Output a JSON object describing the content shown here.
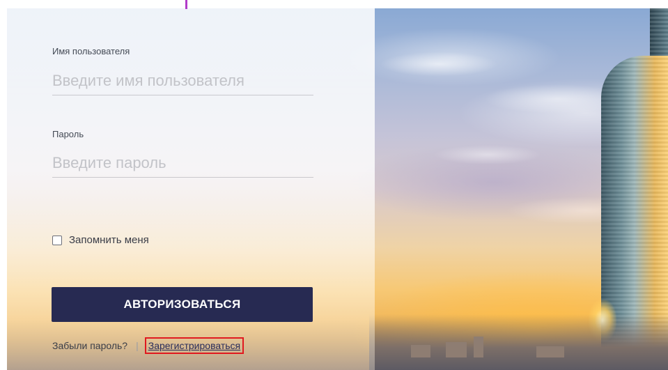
{
  "login": {
    "username_label": "Имя пользователя",
    "username_placeholder": "Введите имя пользователя",
    "password_label": "Пароль",
    "password_placeholder": "Введите пароль",
    "remember_label": "Запомнить меня",
    "remember_checked": false,
    "submit_label": "АВТОРИЗОВАТЬСЯ",
    "forgot_label": "Забыли пароль?",
    "separator": "|",
    "register_label": "Зарегистрироваться"
  },
  "colors": {
    "button_bg": "#272a52",
    "highlight_border": "#e0191f",
    "accent": "#b13bc9"
  }
}
